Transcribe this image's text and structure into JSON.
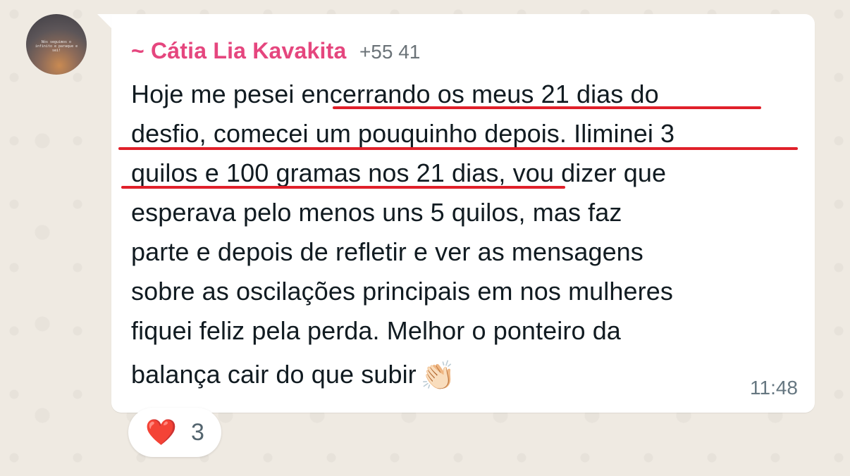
{
  "message": {
    "sender_name": "~ Cátia Lia Kavakita",
    "sender_phone": "+55 41",
    "lines": [
      "Hoje me pesei encerrando os meus 21 dias do",
      "desfio, comecei um pouquinho depois. Iliminei 3",
      "quilos e 100 gramas nos 21 dias, vou dizer que",
      "esperava pelo menos uns 5 quilos, mas faz",
      "parte e depois de refletir e ver as mensagens",
      "sobre as oscilações principais em nos  mulheres",
      "fiquei feliz pela perda. Melhor o ponteiro da",
      "balança cair do que subir"
    ],
    "clap_emoji": "👏🏻",
    "time": "11:48",
    "annotation_color": "#e0202a"
  },
  "reaction": {
    "emoji": "❤️",
    "count": "3"
  },
  "avatar": {
    "caption": "Nós seguimos o infinito e paraque e sei!"
  },
  "colors": {
    "sender_name": "#e5467e",
    "background": "#efeae2",
    "bubble": "#ffffff"
  }
}
